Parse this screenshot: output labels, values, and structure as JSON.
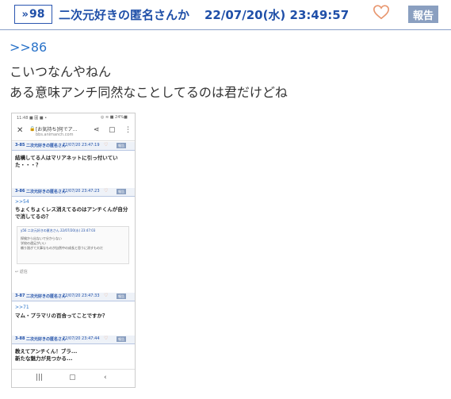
{
  "header": {
    "post_number_arrow": "»",
    "post_number": "98",
    "poster_name": "二次元好きの匿名さんか",
    "datetime": "22/07/20(水) 23:49:57",
    "report_label": "報告",
    "accent_color": "#1f4fa8",
    "heart_color": "#e8956d"
  },
  "body": {
    "anchor": ">>86",
    "lines": [
      "こいつなんやねん",
      "ある意味アンチ同然なことしてるのは君だけどね"
    ]
  },
  "thumbnail": {
    "status_time": "11:48 ■ 圓 ■ •",
    "status_battery": "◎ ≋ ■ 24%■",
    "url_title": "[お気持ち]何でア...",
    "url_sub": "bbs.animanch.com",
    "posts": [
      {
        "number": "3-85",
        "poster": "二次元好きの匿名さん",
        "datetime": "22/07/20 23:47:19",
        "report": "報告",
        "text_lines": [
          "結構してる人はマリアネットに引っ付いてい",
          "た・・・？"
        ]
      },
      {
        "number": "3-86",
        "poster": "二次元好きの匿名さん",
        "datetime": "22/07/20 23:47:23",
        "report": "報告",
        "anchor": ">>54",
        "text_lines": [
          "ちょくちょくレス消えてるのはアンチくんが自分",
          "で消してるの？"
        ],
        "quote_header": "y56 二次元好きの匿名さん 22/07/20(水) 23:47:03",
        "quote_lines": [
          "探検から出ないで分からない",
          "学校の遠足がいい",
          "頼り過ぎて大事なものが自然中の成長と思うに消すものだ"
        ],
        "reply_label": "返信"
      },
      {
        "number": "3-87",
        "poster": "二次元好きの匿名さん",
        "datetime": "22/07/20 23:47:33",
        "report": "報告",
        "anchor": ">>71",
        "text_lines": [
          "マム・プラマリの百合ってことですか？"
        ]
      },
      {
        "number": "3-88",
        "poster": "二次元好きの匿名さん",
        "datetime": "22/07/20 23:47:44",
        "report": "報告",
        "text_lines": [
          "教えてアンチくん！ブラ...",
          "新たな魅力が見つかる..."
        ]
      }
    ]
  }
}
